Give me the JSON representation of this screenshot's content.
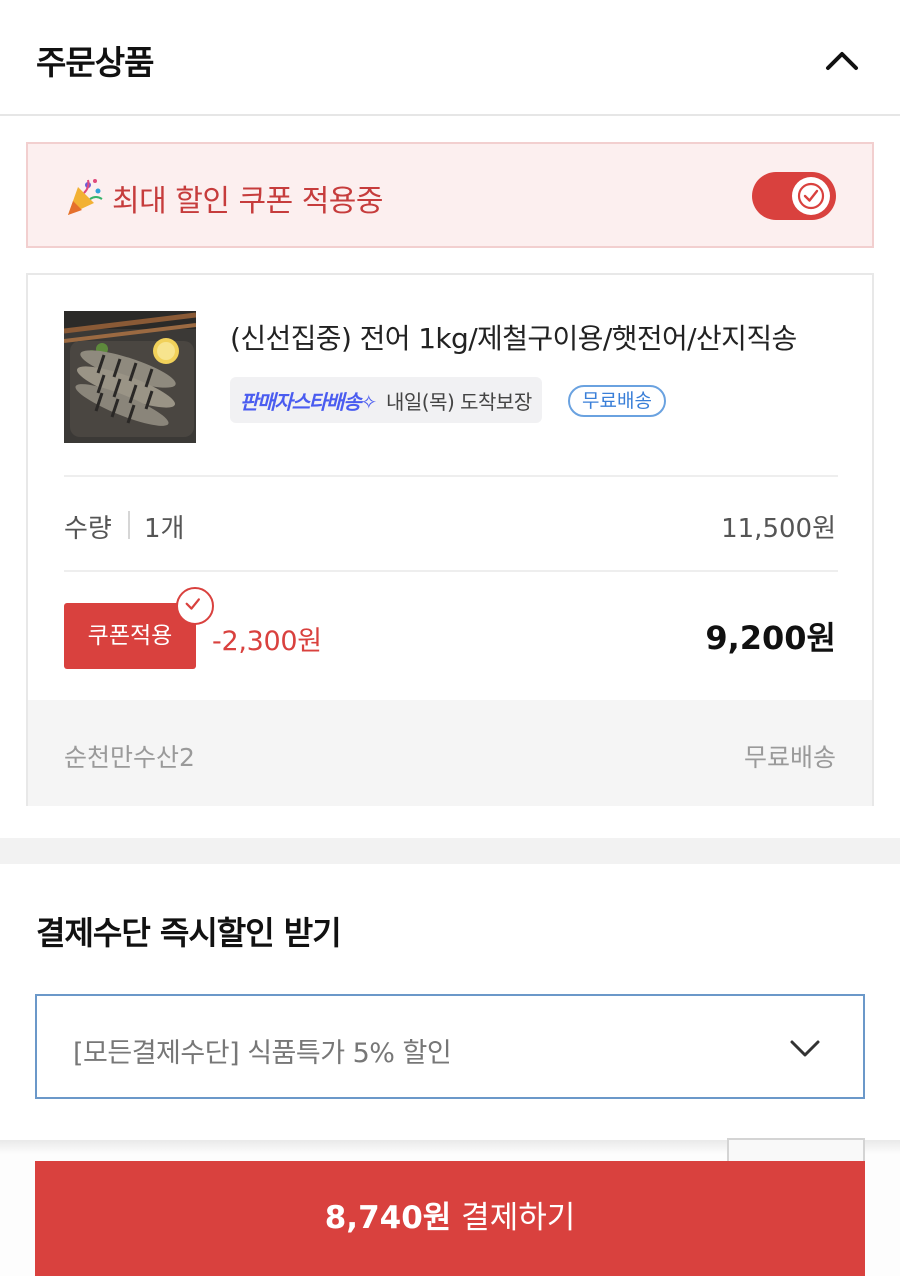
{
  "header": {
    "title": "주문상품",
    "collapse_icon": "chevron-up-icon"
  },
  "coupon_banner": {
    "icon": "party-popper-icon",
    "text": "최대 할인 쿠폰 적용중",
    "toggle_on": true
  },
  "product": {
    "name": "(신선집중) 전어 1kg/제철구이용/햇전어/산지직송",
    "badge_star": "판매자스타배송✧",
    "arrival": "내일(목) 도착보장",
    "free_shipping_pill": "무료배송",
    "qty_label": "수량",
    "qty_value": "1개",
    "unit_price": "11,500원",
    "coupon_button": "쿠폰적용",
    "discount": "-2,300원",
    "final_price": "9,200원",
    "seller": "순천만수산2",
    "shipping": "무료배송"
  },
  "payment": {
    "title": "결제수단 즉시할인 받기",
    "selected": "[모든결제수단] 식품특가 5% 할인"
  },
  "checkout": {
    "amount": "8,740원",
    "label": "결제하기"
  },
  "colors": {
    "accent": "#d9413e",
    "banner_bg": "#fcefef",
    "star_blue": "#4a5cf0"
  }
}
